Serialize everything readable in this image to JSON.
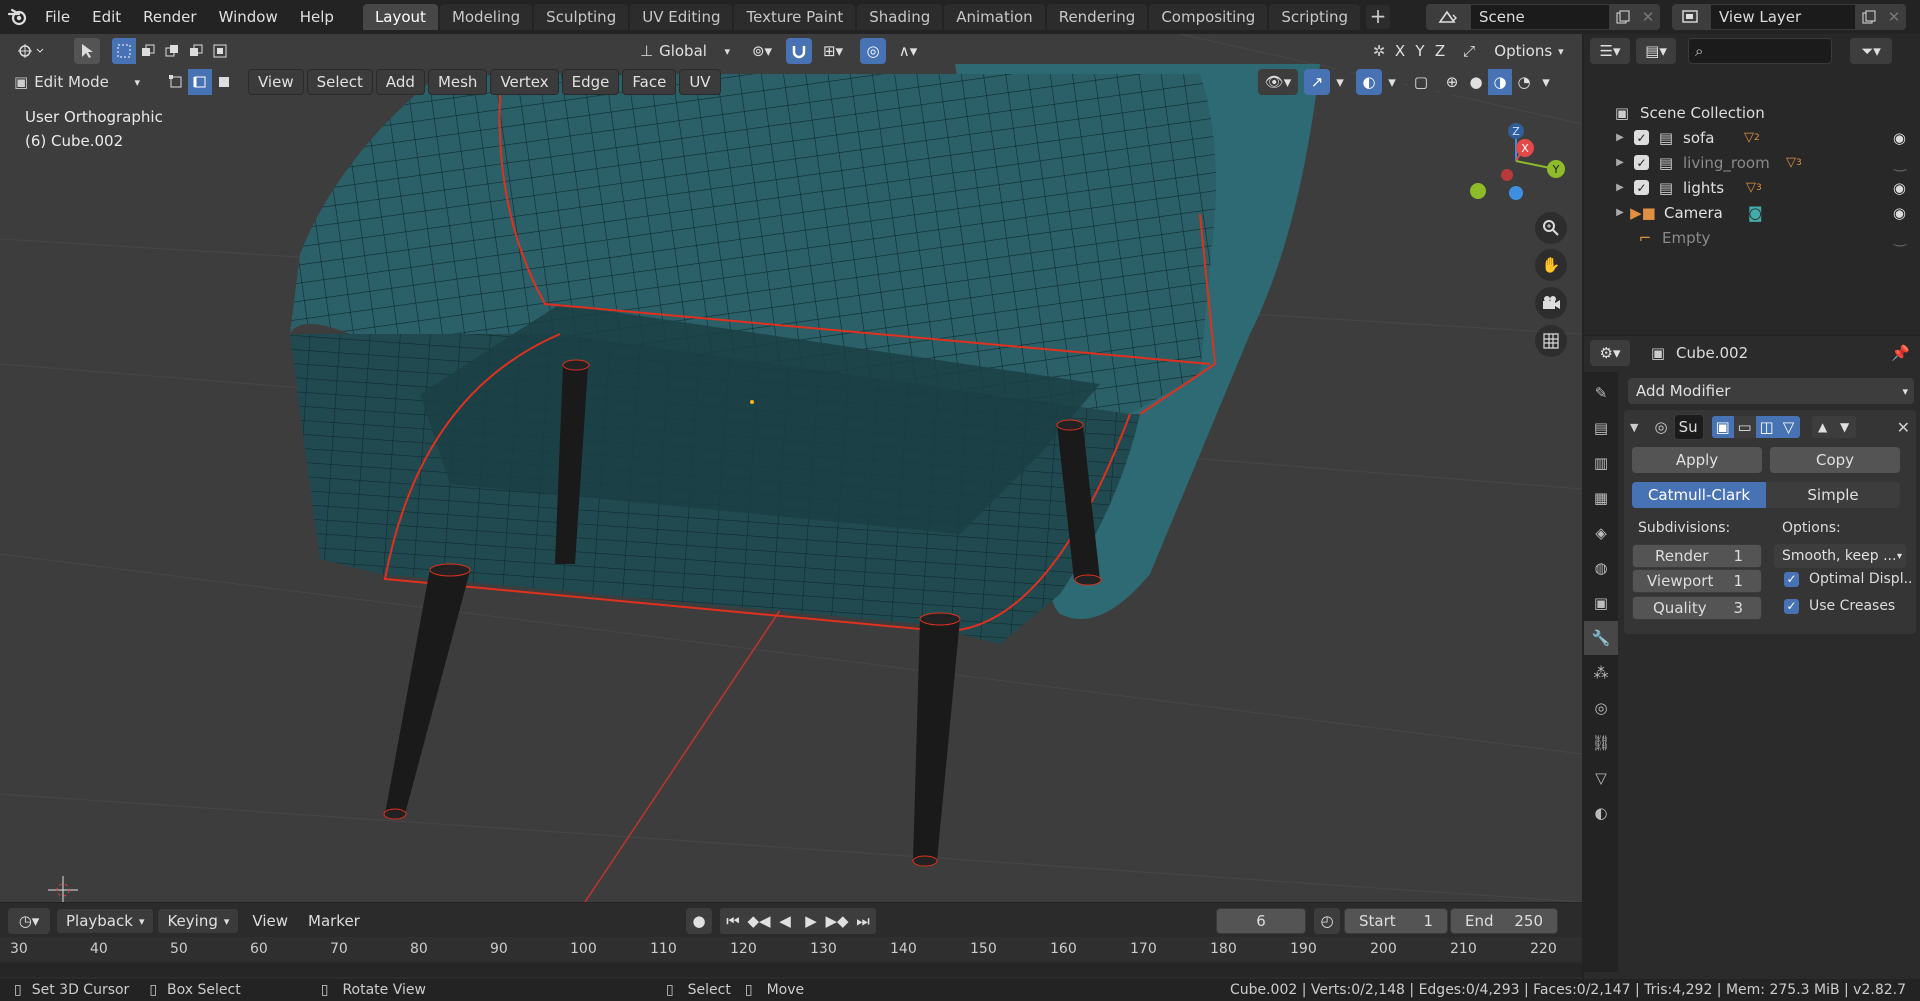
{
  "menu": {
    "file": "File",
    "edit": "Edit",
    "render": "Render",
    "window": "Window",
    "help": "Help"
  },
  "workspaces": [
    "Layout",
    "Modeling",
    "Sculpting",
    "UV Editing",
    "Texture Paint",
    "Shading",
    "Animation",
    "Rendering",
    "Compositing",
    "Scripting"
  ],
  "active_workspace": "Layout",
  "scene": {
    "name": "Scene",
    "view_layer": "View Layer"
  },
  "viewport": {
    "mode": "Edit Mode",
    "menus": {
      "view": "View",
      "select": "Select",
      "add": "Add",
      "mesh": "Mesh",
      "vertex": "Vertex",
      "edge": "Edge",
      "face": "Face",
      "uv": "UV"
    },
    "transform_orientation": "Global",
    "options": "Options",
    "axes": {
      "x": "X",
      "y": "Y",
      "z": "Z"
    },
    "view_name": "User Orthographic",
    "object_info": "(6) Cube.002",
    "gizmo": {
      "x": "X",
      "y": "Y",
      "z": "Z"
    }
  },
  "outliner": {
    "search_placeholder": "",
    "root": "Scene Collection",
    "items": [
      {
        "name": "sofa",
        "badge": "2",
        "visible": true
      },
      {
        "name": "living_room",
        "badge": "3",
        "visible": false
      },
      {
        "name": "lights",
        "badge": "3",
        "visible": true
      },
      {
        "name": "Camera",
        "badge": "",
        "visible": true
      },
      {
        "name": "Empty",
        "badge": "",
        "visible": false
      }
    ]
  },
  "properties": {
    "object": "Cube.002",
    "add_modifier": "Add Modifier",
    "modifier_short": "Su",
    "apply": "Apply",
    "copy": "Copy",
    "catmull": "Catmull-Clark",
    "simple": "Simple",
    "subdivisions_label": "Subdivisions:",
    "options_label": "Options:",
    "render_label": "Render",
    "render_value": "1",
    "viewport_label": "Viewport",
    "viewport_value": "1",
    "quality_label": "Quality",
    "quality_value": "3",
    "uv_smooth": "Smooth, keep ...",
    "optimal_display": "Optimal Displ..",
    "use_creases": "Use Creases"
  },
  "timeline": {
    "playback": "Playback",
    "keying": "Keying",
    "view": "View",
    "marker": "Marker",
    "current_frame": "6",
    "start_label": "Start",
    "start": "1",
    "end_label": "End",
    "end": "250",
    "ruler": [
      "30",
      "40",
      "50",
      "60",
      "70",
      "80",
      "90",
      "100",
      "110",
      "120",
      "130",
      "140",
      "150",
      "160",
      "170",
      "180",
      "190",
      "200",
      "210",
      "220"
    ]
  },
  "status": {
    "set_cursor": "Set 3D Cursor",
    "box_select": "Box Select",
    "rotate_view": "Rotate View",
    "select": "Select",
    "move": "Move",
    "stats": "Cube.002 | Verts:0/2,148 | Edges:0/4,293 | Faces:0/2,147 | Tris:4,292 | Mem: 275.3 MiB | v2.82.7"
  },
  "colors": {
    "accent": "#4772b3",
    "mesh": "#2a5a60",
    "edge_selected": "#e0301e",
    "x_axis": "#e24a4a",
    "y_axis": "#8dbb2a",
    "z_axis": "#3f8fe0"
  }
}
